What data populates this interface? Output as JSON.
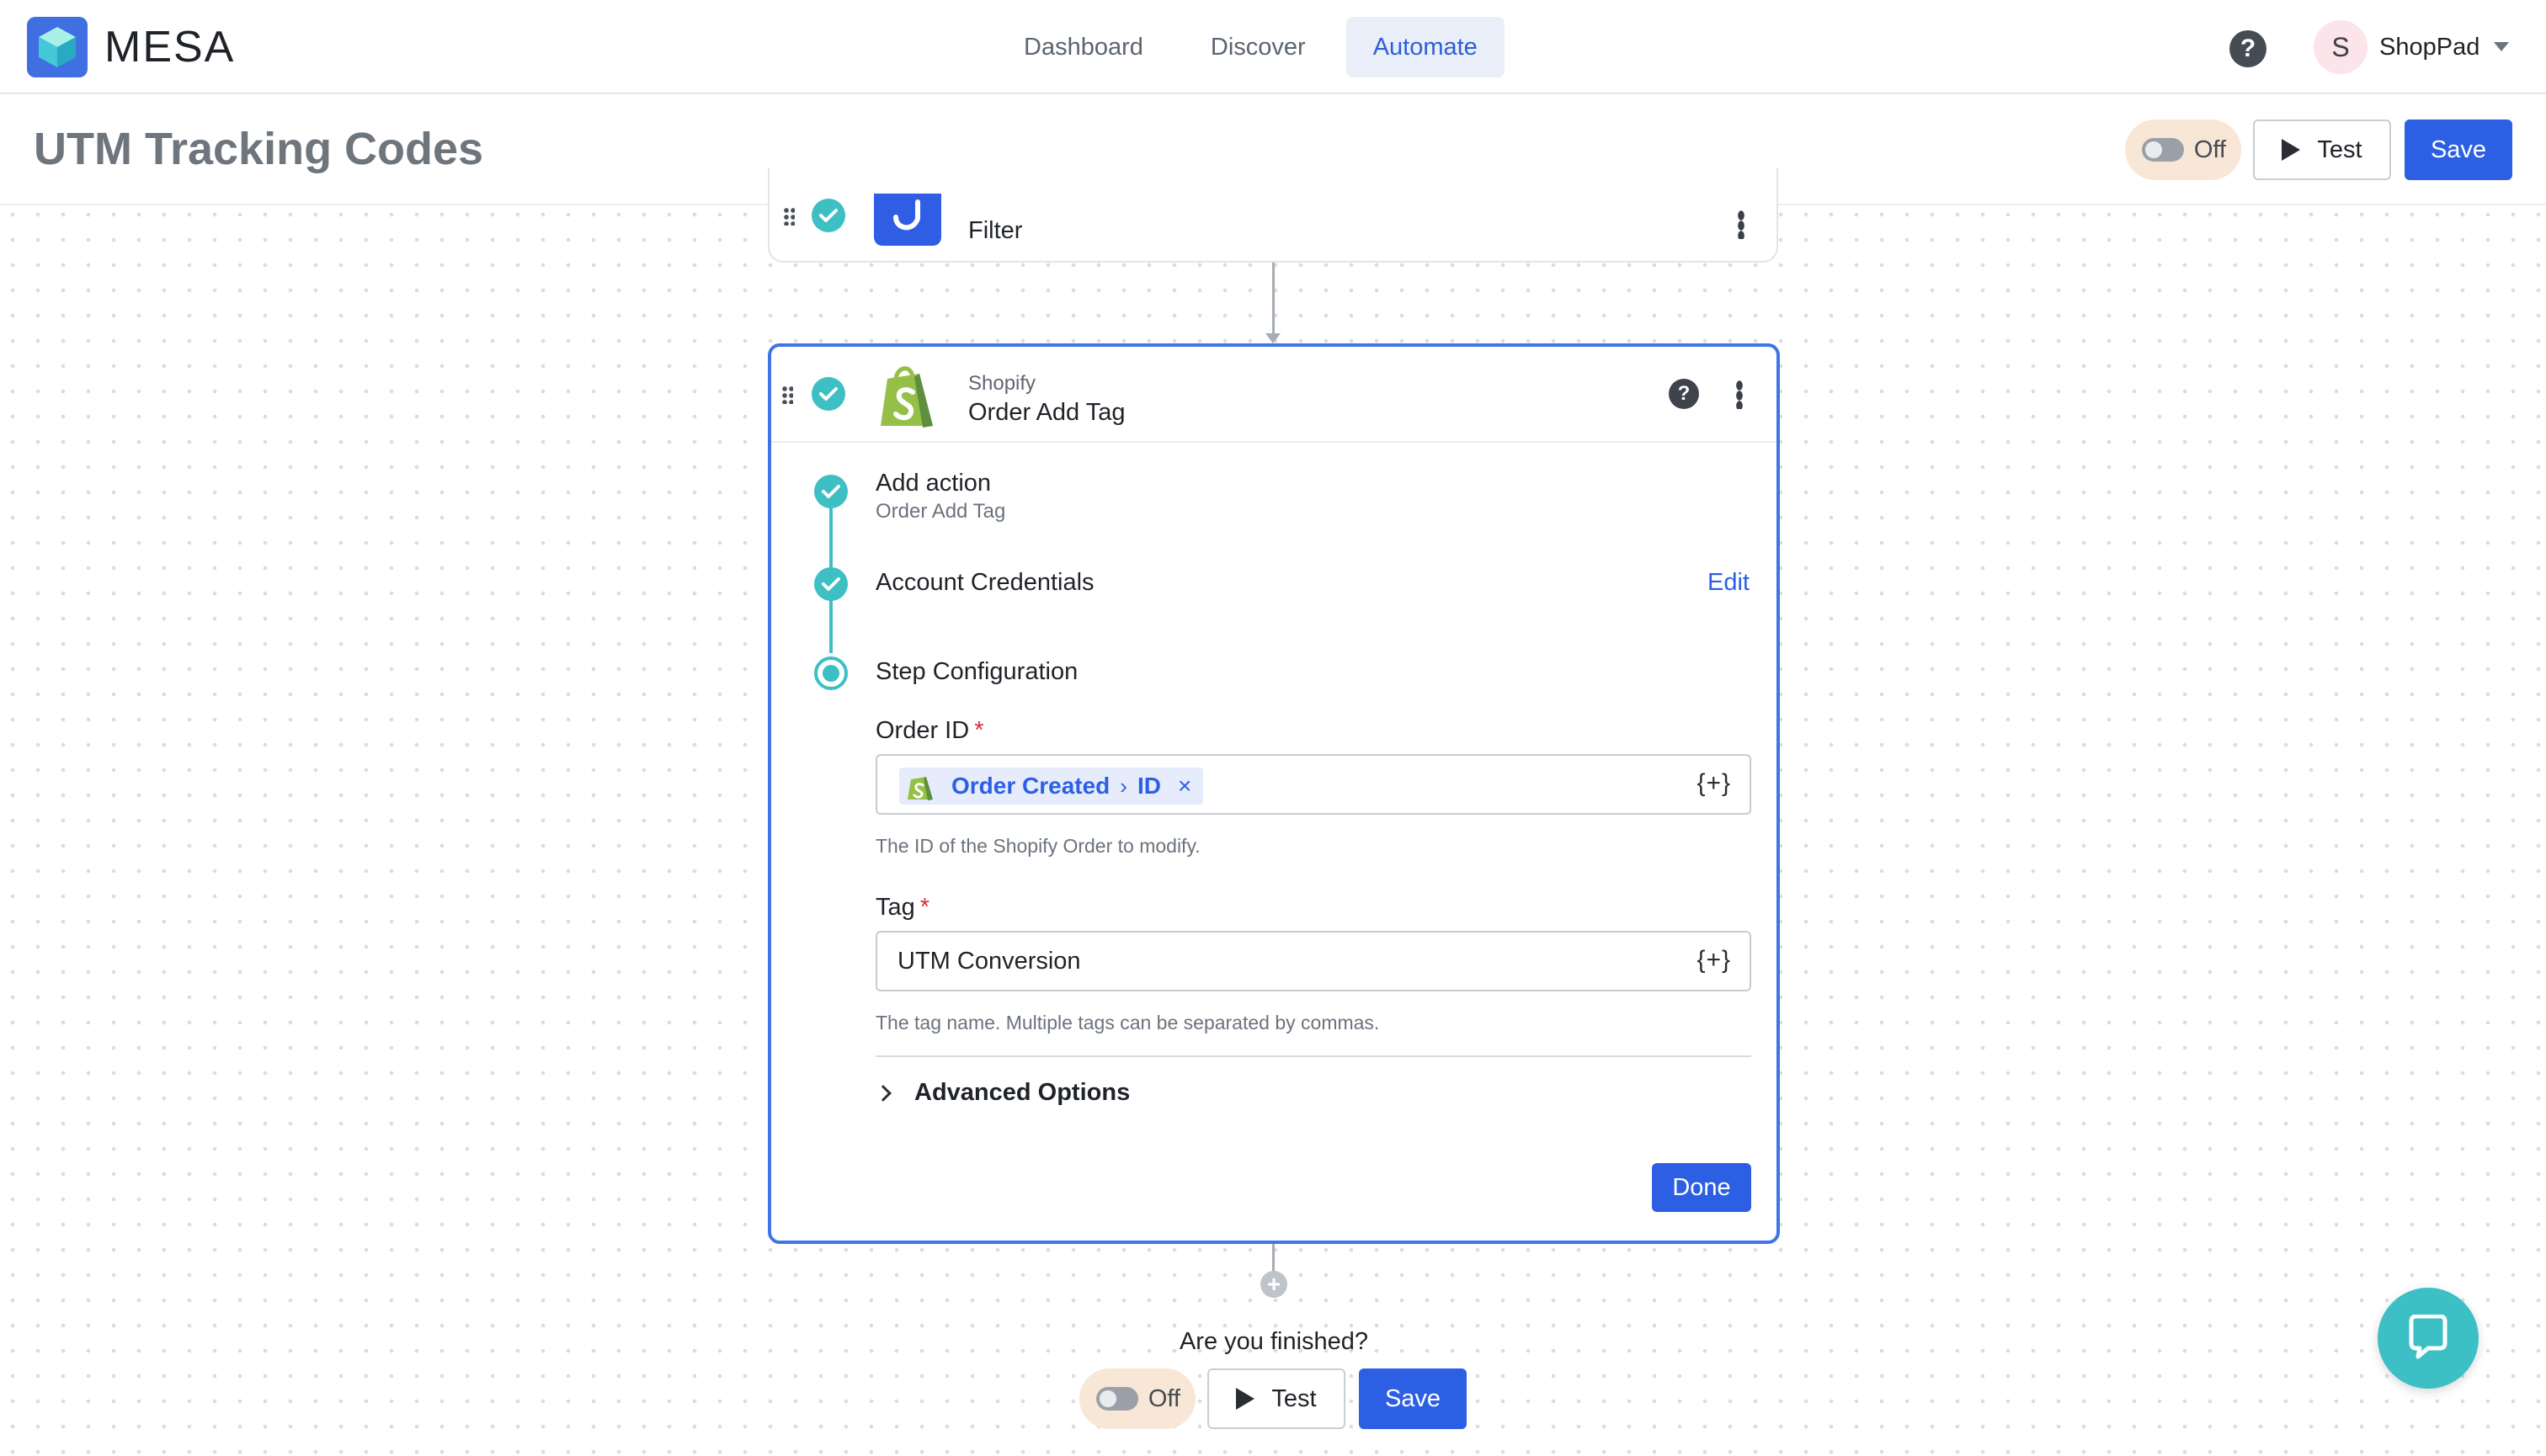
{
  "app": {
    "brand": "MESA"
  },
  "nav": {
    "items": [
      "Dashboard",
      "Discover",
      "Automate"
    ],
    "active": "Automate"
  },
  "user": {
    "initial": "S",
    "name": "ShopPad"
  },
  "page": {
    "title": "UTM Tracking Codes"
  },
  "toolbar": {
    "toggle_label": "Off",
    "test_label": "Test",
    "save_label": "Save"
  },
  "filter_step": {
    "name": "Filter"
  },
  "action_step": {
    "app": "Shopify",
    "name": "Order Add Tag",
    "steps": [
      {
        "title": "Add action",
        "subtitle": "Order Add Tag"
      },
      {
        "title": "Account Credentials",
        "action": "Edit"
      },
      {
        "title": "Step Configuration"
      }
    ],
    "fields": [
      {
        "label": "Order ID",
        "required_mark": "*",
        "token": {
          "source": "Order Created",
          "field": "ID",
          "remove": "×"
        },
        "variable_button": "{+}",
        "hint": "The ID of the Shopify Order to modify."
      },
      {
        "label": "Tag",
        "required_mark": "*",
        "value": "UTM Conversion",
        "variable_button": "{+}",
        "hint": "The tag name. Multiple tags can be separated by commas."
      }
    ],
    "advanced_label": "Advanced Options",
    "done_label": "Done"
  },
  "footer": {
    "question": "Are you finished?",
    "toggle_label": "Off",
    "test_label": "Test",
    "save_label": "Save"
  },
  "colors": {
    "accent": "#2c5fe3",
    "teal": "#3dbfc4",
    "toggle_bg": "#f8e6d6"
  }
}
